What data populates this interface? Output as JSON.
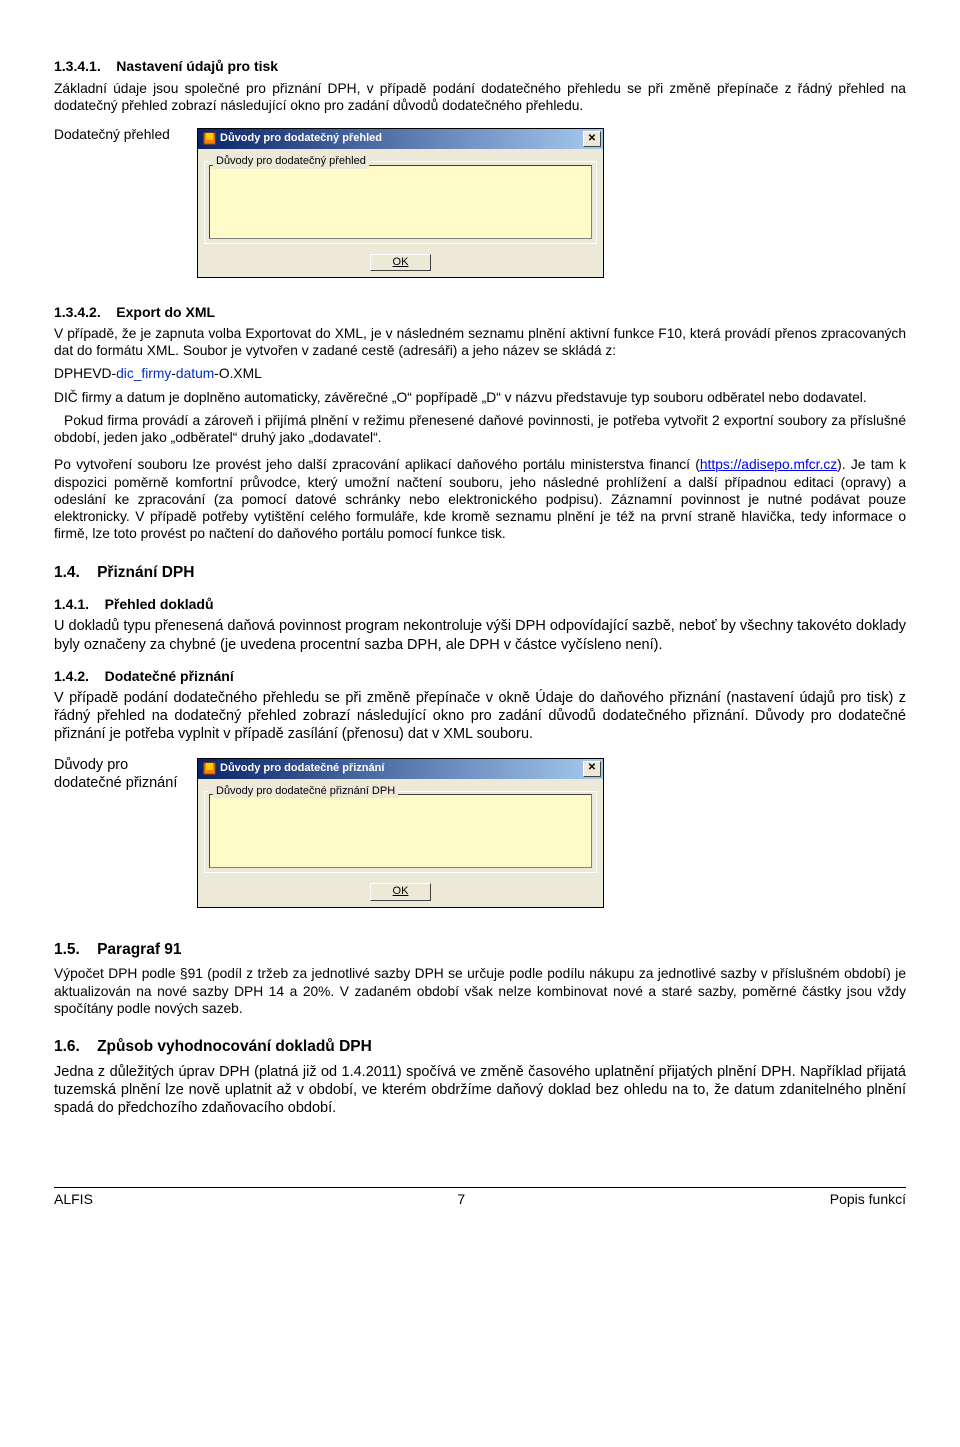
{
  "sections": {
    "s1341": {
      "num": "1.3.4.1.",
      "title": "Nastavení údajů pro tisk"
    },
    "s1342": {
      "num": "1.3.4.2.",
      "title": "Export do XML"
    },
    "s14": {
      "num": "1.4.",
      "title": "Přiznání DPH"
    },
    "s141": {
      "num": "1.4.1.",
      "title": "Přehled dokladů"
    },
    "s142": {
      "num": "1.4.2.",
      "title": "Dodatečné přiznání"
    },
    "s15": {
      "num": "1.5.",
      "title": "Paragraf 91"
    },
    "s16": {
      "num": "1.6.",
      "title": "Způsob vyhodnocování dokladů DPH"
    }
  },
  "p_s1341": "Základní údaje jsou společné pro přiznání DPH, v případě podání dodatečného přehledu se při změně přepínače z řádný přehled na dodatečný přehled zobrazí následující okno pro zadání důvodů dodatečného přehledu.",
  "label_dod_prehled": "Dodatečný přehled",
  "dialog1": {
    "title": "Důvody pro dodatečný přehled",
    "group": "Důvody pro dodatečný přehled",
    "ok": "OK"
  },
  "p_s1342_a": "V případě, že je zapnuta volba Exportovat do XML, je v následném seznamu plnění aktivní funkce F10, která provádí přenos zpracovaných dat do formátu XML. Soubor je vytvořen v zadané cestě (adresáři) a jeho název se skládá z:",
  "fname_a": "DPHEVD-",
  "fname_b": "dic_firmy",
  "fname_c": "-",
  "fname_d": "datum",
  "fname_e": "-O.XML",
  "p_s1342_b": "DIČ firmy a datum je doplněno automaticky, závěrečné „O“ popřípadě „D“ v názvu představuje typ souboru odběratel nebo dodavatel.",
  "p_s1342_c": "Pokud firma provádí a zároveň i přijímá plnění v režimu přenesené daňové povinnosti, je potřeba vytvořit 2 exportní soubory za příslušné období, jeden jako „odběratel“ druhý jako „dodavatel“.",
  "p_s1342_d1": "Po vytvoření souboru lze provést jeho další zpracování aplikací daňového portálu ministerstva financí (",
  "p_s1342_link": "https://adisepo.mfcr.cz",
  "p_s1342_d2": "). Je tam k dispozici poměrně komfortní průvodce, který umožní načtení souboru, jeho následné prohlížení a další případnou editaci (opravy) a odeslání ke zpracování (za pomocí datové schránky nebo elektronického podpisu). Záznamní povinnost je nutné podávat pouze elektronicky. V případě potřeby vytištění celého formuláře, kde kromě seznamu plnění je též na první straně hlavička, tedy informace o firmě, lze toto provést po načtení do daňového portálu pomocí funkce tisk.",
  "p_s141": "U dokladů typu přenesená daňová povinnost program nekontroluje výši DPH odpovídající sazbě, neboť by všechny takovéto doklady byly označeny za chybné (je uvedena procentní sazba DPH, ale DPH v částce vyčísleno není).",
  "p_s142": "V případě podání dodatečného přehledu se při změně přepínače v okně Údaje do daňového přiznání (nastavení údajů pro tisk) z řádný přehled na dodatečný přehled zobrazí následující okno pro zadání důvodů dodatečného přiznání. Důvody pro dodatečné přiznání je potřeba vyplnit v případě zasílání (přenosu) dat v XML souboru.",
  "label_dod_priznani": "Důvody pro dodatečné přiznání",
  "dialog2": {
    "title": "Důvody pro dodatečné přiznání",
    "group": "Důvody pro dodatečné přiznání DPH",
    "ok": "OK"
  },
  "p_s15": "Výpočet DPH podle §91 (podíl z tržeb za jednotlivé sazby DPH se určuje podle podílu nákupu za jednotlivé sazby v příslušném období) je aktualizován na nové sazby DPH 14 a 20%. V zadaném období však nelze kombinovat nové a staré sazby, poměrné částky jsou vždy spočítány podle nových sazeb.",
  "p_s16": "Jedna z důležitých úprav DPH (platná již od 1.4.2011) spočívá ve změně časového uplatnění přijatých plnění DPH. Například přijatá tuzemská plnění lze nově uplatnit až v období, ve kterém obdržíme daňový doklad bez ohledu na to, že datum zdanitelného plnění spadá do předchozího zdaňovacího období.",
  "footer": {
    "left": "ALFIS",
    "page": "7",
    "right": "Popis funkcí"
  }
}
